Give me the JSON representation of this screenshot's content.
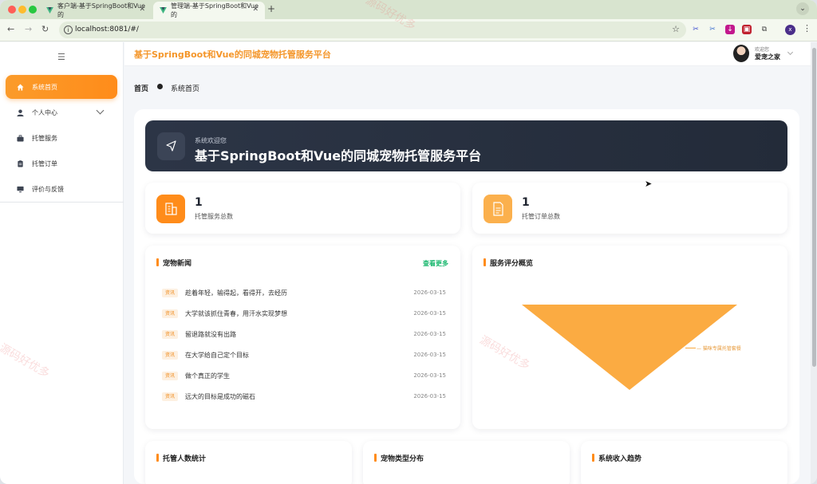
{
  "browser": {
    "tabs": [
      {
        "title": "客户端-基于SpringBoot和Vue的"
      },
      {
        "title": "管理端-基于SpringBoot和Vue的"
      }
    ],
    "new_tab": "+",
    "url": "localhost:8081/#/",
    "profile_initial": "x"
  },
  "sidebar": {
    "items": [
      {
        "label": "系统首页",
        "icon": "home-icon"
      },
      {
        "label": "个人中心",
        "icon": "user-icon"
      },
      {
        "label": "托管服务",
        "icon": "briefcase-icon"
      },
      {
        "label": "托管订单",
        "icon": "clipboard-icon"
      },
      {
        "label": "评价与反馈",
        "icon": "monitor-icon"
      }
    ]
  },
  "header": {
    "title": "基于SpringBoot和Vue的同城宠物托管服务平台",
    "welcome": "欢迎您",
    "username": "爱宠之家"
  },
  "breadcrumb": {
    "home": "首页",
    "current": "系统首页"
  },
  "banner": {
    "subtitle": "系统欢迎您",
    "title": "基于SpringBoot和Vue的同城宠物托管服务平台"
  },
  "stats": [
    {
      "value": "1",
      "label": "托管服务总数",
      "color": "#ff8c1a"
    },
    {
      "value": "1",
      "label": "托管订单总数",
      "color": "#fbb04d"
    }
  ],
  "news": {
    "title": "宠物新闻",
    "more": "查看更多",
    "tag": "资讯",
    "items": [
      {
        "text": "趁着年轻，输得起，看得开，去经历",
        "date": "2026-03-15"
      },
      {
        "text": "大学就该抓住青春，用汗水实现梦想",
        "date": "2026-03-15"
      },
      {
        "text": "留退路就没有出路",
        "date": "2026-03-15"
      },
      {
        "text": "在大学给自己定个目标",
        "date": "2026-03-15"
      },
      {
        "text": "做个真正的学生",
        "date": "2026-03-15"
      },
      {
        "text": "远大的目标是成功的磁石",
        "date": "2026-03-15"
      }
    ]
  },
  "rating": {
    "title": "服务评分概览",
    "legend": "— 猫咪专属托管套餐"
  },
  "bottom_cards": [
    {
      "title": "托管人数统计"
    },
    {
      "title": "宠物类型分布"
    },
    {
      "title": "系统收入趋势"
    }
  ],
  "watermark": "源码好优多",
  "colors": {
    "accent": "#ff8c1a",
    "header_title": "#f4962a",
    "banner_bg": "#2c3546",
    "link_green": "#19b76e",
    "funnel": "#fbab42"
  }
}
